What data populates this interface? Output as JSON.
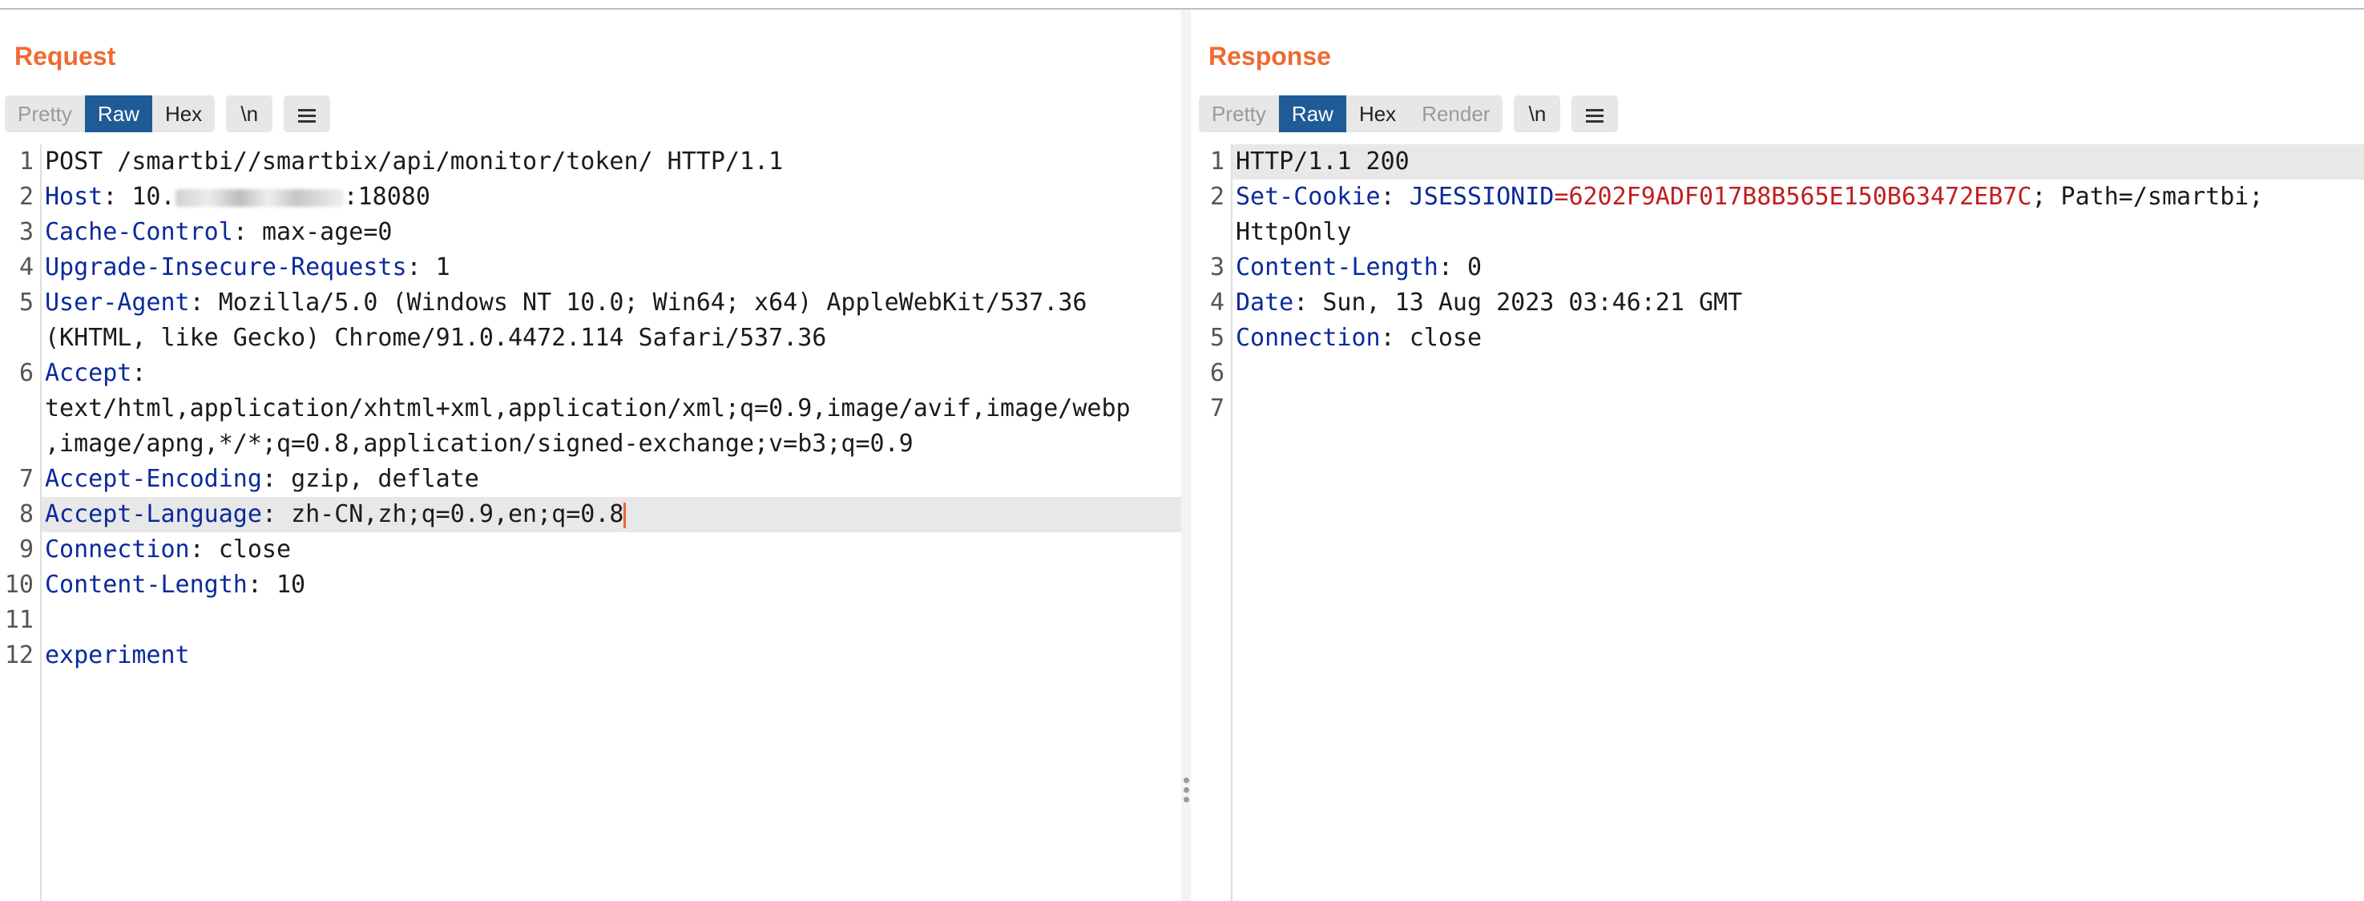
{
  "request": {
    "title": "Request",
    "tabs": [
      {
        "label": "Pretty",
        "state": "inactive"
      },
      {
        "label": "Raw",
        "state": "active"
      },
      {
        "label": "Hex",
        "state": "inactive"
      }
    ],
    "newline_button": "\\n",
    "menu_icon": "hamburger-menu-icon",
    "line_numbers": [
      "1",
      "2",
      "3",
      "4",
      "5",
      "6",
      "7",
      "8",
      "9",
      "10",
      "11",
      "12"
    ],
    "lines": {
      "l1": "POST /smartbi//smartbix/api/monitor/token/ HTTP/1.1",
      "l2_key": "Host",
      "l2_pre": "10.",
      "l2_post": ":18080",
      "l3_key": "Cache-Control",
      "l3_val": "max-age=0",
      "l4_key": "Upgrade-Insecure-Requests",
      "l4_val": "1",
      "l5_key": "User-Agent",
      "l5_val": "Mozilla/5.0 (Windows NT 10.0; Win64; x64) AppleWebKit/537.36",
      "l5_cont": "(KHTML, like Gecko) Chrome/91.0.4472.114 Safari/537.36",
      "l6_key": "Accept",
      "l6_cont1": "text/html,application/xhtml+xml,application/xml;q=0.9,image/avif,image/webp",
      "l6_cont2": ",image/apng,*/*;q=0.8,application/signed-exchange;v=b3;q=0.9",
      "l7_key": "Accept-Encoding",
      "l7_val": "gzip, deflate",
      "l8_key": "Accept-Language",
      "l8_val": "zh-CN,zh;q=0.9,en;q=0.8",
      "l9_key": "Connection",
      "l9_val": "close",
      "l10_key": "Content-Length",
      "l10_val": "10",
      "l12": "experiment"
    }
  },
  "response": {
    "title": "Response",
    "tabs": [
      {
        "label": "Pretty",
        "state": "inactive"
      },
      {
        "label": "Raw",
        "state": "active"
      },
      {
        "label": "Hex",
        "state": "inactive"
      },
      {
        "label": "Render",
        "state": "inactive"
      }
    ],
    "newline_button": "\\n",
    "menu_icon": "hamburger-menu-icon",
    "line_numbers": [
      "1",
      "2",
      "3",
      "4",
      "5",
      "6",
      "7"
    ],
    "lines": {
      "l1": "HTTP/1.1 200",
      "l2_key": "Set-Cookie",
      "l2_cookie_name": "JSESSIONID",
      "l2_eq": "=",
      "l2_cookie_val": "6202F9ADF017B8B565E150B63472EB7C",
      "l2_rest": "; Path=/smartbi;",
      "l2_cont": "HttpOnly",
      "l3_key": "Content-Length",
      "l3_val": "0",
      "l4_key": "Date",
      "l4_val": "Sun, 13 Aug 2023 03:46:21 GMT",
      "l5_key": "Connection",
      "l5_val": "close"
    }
  },
  "layout_buttons": [
    {
      "icon": "split-horizontal-icon",
      "active": true
    },
    {
      "icon": "split-vertical-icon",
      "active": false
    },
    {
      "icon": "single-pane-icon",
      "active": false
    }
  ],
  "colors": {
    "title": "#ef6a33",
    "active_tab": "#1f5b97",
    "header_key": "#0b2a9c",
    "cookie_value": "#c01f1f",
    "caret": "#ef6a33"
  }
}
